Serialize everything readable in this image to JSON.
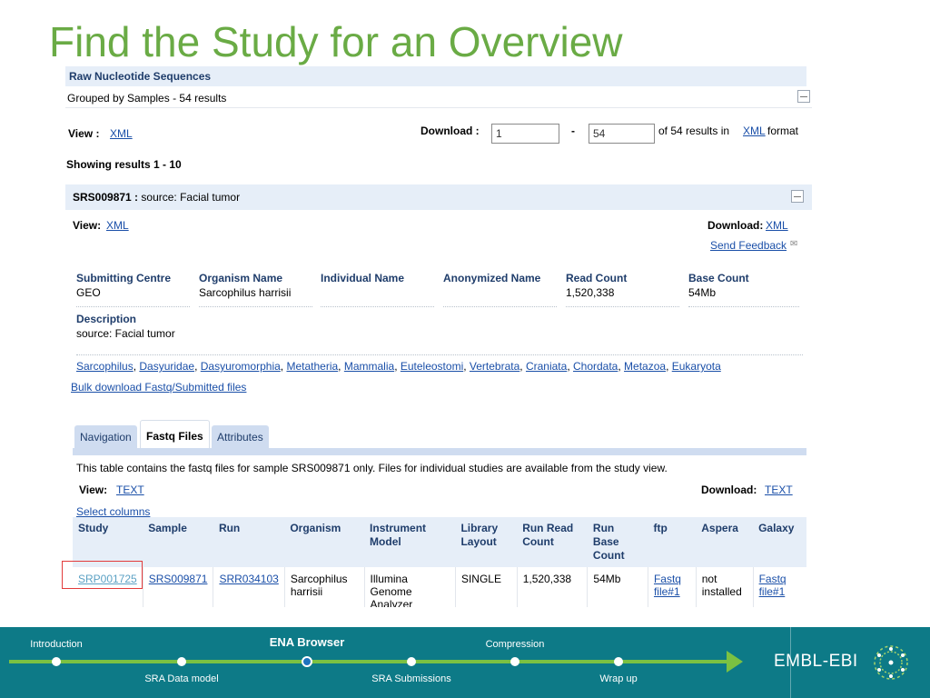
{
  "slide": {
    "title": "Find the Study for an Overview"
  },
  "results": {
    "section_title": "Raw Nucleotide Sequences",
    "grouped_label": "Grouped by Samples - 54 results",
    "view_label": "View :",
    "view_xml": "XML",
    "download_label": "Download :",
    "download_from": "1",
    "download_dash": "-",
    "download_to": "54",
    "download_suffix": "of 54 results in",
    "download_format_link": "XML",
    "download_format_word": "format",
    "showing": "Showing results 1 - 10"
  },
  "sample": {
    "accession": "SRS009871 :",
    "source": "source: Facial tumor",
    "view_label": "View:",
    "view_xml": "XML",
    "download_label": "Download:",
    "download_xml": "XML",
    "send_feedback": "Send Feedback",
    "meta": [
      {
        "header": "Submitting Centre",
        "value": "GEO"
      },
      {
        "header": "Organism Name",
        "value": "Sarcophilus harrisii"
      },
      {
        "header": "Individual Name",
        "value": ""
      },
      {
        "header": "Anonymized Name",
        "value": ""
      },
      {
        "header": "Read Count",
        "value": "1,520,338"
      },
      {
        "header": "Base Count",
        "value": "54Mb"
      }
    ],
    "description_header": "Description",
    "description_value": "source: Facial tumor",
    "taxonomy": [
      "Sarcophilus",
      "Dasyuridae",
      "Dasyuromorphia",
      "Metatheria",
      "Mammalia",
      "Euteleostomi",
      "Vertebrata",
      "Craniata",
      "Chordata",
      "Metazoa",
      "Eukaryota"
    ],
    "bulk_download": "Bulk download Fastq/Submitted files"
  },
  "tabs": [
    "Navigation",
    "Fastq Files",
    "Attributes"
  ],
  "fastq": {
    "note": "This table contains the fastq files for sample SRS009871 only. Files for individual studies are available from the study view.",
    "view_label": "View:",
    "view_text": "TEXT",
    "download_label": "Download:",
    "download_text": "TEXT",
    "select_columns": "Select columns",
    "columns": [
      "Study",
      "Sample",
      "Run",
      "Organism",
      "Instrument Model",
      "Library Layout",
      "Run Read Count",
      "Run Base Count",
      "ftp",
      "Aspera",
      "Galaxy"
    ],
    "row": {
      "study": "SRP001725",
      "sample": "SRS009871",
      "run": "SRR034103",
      "organism": "Sarcophilus harrisii",
      "instrument": "Illumina Genome Analyzer",
      "layout": "SINGLE",
      "read_count": "1,520,338",
      "base_count": "54Mb",
      "ftp": "Fastq file#1",
      "aspera": "not installed",
      "galaxy": "Fastq file#1"
    }
  },
  "nav": {
    "top": [
      "Introduction",
      "ENA Browser",
      "Compression"
    ],
    "bottom": [
      "SRA Data model",
      "SRA Submissions",
      "Wrap up"
    ],
    "current": "ENA Browser",
    "logo": "EMBL-EBI"
  },
  "colors": {
    "title": "#6aab45",
    "nav_bg": "#0d7a87",
    "track": "#7bc142",
    "highlight": "#e23b3b"
  }
}
